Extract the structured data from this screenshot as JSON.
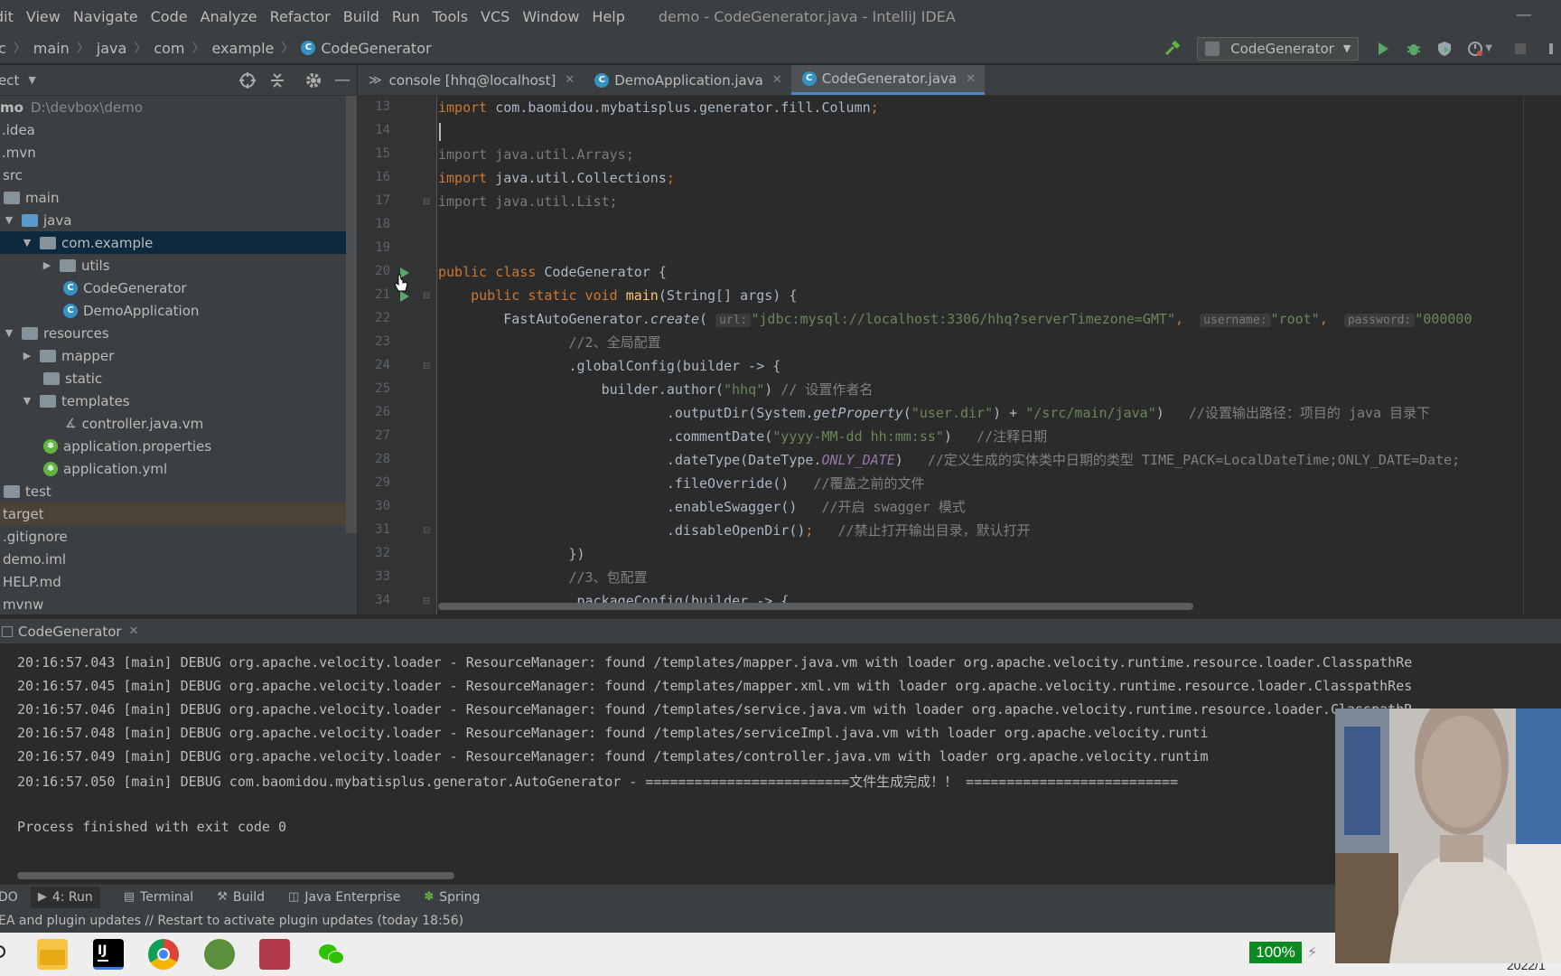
{
  "menubar": {
    "items": [
      "dit",
      "View",
      "Navigate",
      "Code",
      "Analyze",
      "Refactor",
      "Build",
      "Run",
      "Tools",
      "VCS",
      "Window",
      "Help"
    ],
    "window_title": "demo - CodeGenerator.java - IntelliJ IDEA"
  },
  "navbar": {
    "crumbs": [
      "c",
      "main",
      "java",
      "com",
      "example",
      "CodeGenerator"
    ],
    "run_config": "CodeGenerator"
  },
  "project": {
    "header": "ect",
    "rows": [
      {
        "label": "mo",
        "extra": "D:\\devbox\\demo"
      },
      {
        "label": ".idea"
      },
      {
        "label": ".mvn"
      },
      {
        "label": "src"
      },
      {
        "label": "main"
      },
      {
        "label": "java"
      },
      {
        "label": "com.example"
      },
      {
        "label": "utils"
      },
      {
        "label": "CodeGenerator"
      },
      {
        "label": "DemoApplication"
      },
      {
        "label": "resources"
      },
      {
        "label": "mapper"
      },
      {
        "label": "static"
      },
      {
        "label": "templates"
      },
      {
        "label": "controller.java.vm"
      },
      {
        "label": "application.properties"
      },
      {
        "label": "application.yml"
      },
      {
        "label": "test"
      },
      {
        "label": "target"
      },
      {
        "label": ".gitignore"
      },
      {
        "label": "demo.iml"
      },
      {
        "label": "HELP.md"
      },
      {
        "label": "mvnw"
      }
    ]
  },
  "tabs": [
    {
      "label": "console [hhq@localhost]"
    },
    {
      "label": "DemoApplication.java"
    },
    {
      "label": "CodeGenerator.java"
    }
  ],
  "editor": {
    "line_numbers": [
      "13",
      "14",
      "15",
      "16",
      "17",
      "18",
      "19",
      "20",
      "21",
      "22",
      "23",
      "24",
      "25",
      "26",
      "27",
      "28",
      "29",
      "30",
      "31",
      "32",
      "33",
      "34"
    ],
    "lines": {
      "l13a": "import ",
      "l13b": "com.baomidou.mybatisplus.generator.fill.Column",
      "l13c": ";",
      "l15": "import java.util.Arrays;",
      "l16a": "import ",
      "l16b": "java.util.Collections",
      "l16c": ";",
      "l17": "import java.util.List;",
      "l20a": "public class ",
      "l20b": "CodeGenerator {",
      "l21a": "    public static void ",
      "l21b": "main",
      "l21c": "(String[] args) {",
      "l22a": "        FastAutoGenerator.",
      "l22b": "create",
      "l22c": "( ",
      "l22h1": "url:",
      "l22s1": "\"jdbc:mysql://localhost:3306/hhq?serverTimezone=GMT\"",
      "l22d1": ",  ",
      "l22h2": "username:",
      "l22s2": "\"root\"",
      "l22d2": ",  ",
      "l22h3": "password:",
      "l22s3": "\"000000",
      "l23": "                //2、全局配置",
      "l24": "                .globalConfig(builder -> {",
      "l25a": "                    builder.author(",
      "l25b": "\"hhq\"",
      "l25c": ") ",
      "l25d": "// 设置作者名",
      "l26a": "                            .outputDir(System.",
      "l26b": "getProperty",
      "l26c": "(",
      "l26d": "\"user.dir\"",
      "l26e": ") + ",
      "l26f": "\"/src/main/java\"",
      "l26g": ")   ",
      "l26h": "//设置输出路径：项目的 java 目录下",
      "l27a": "                            .commentDate(",
      "l27b": "\"yyyy-MM-dd hh:mm:ss\"",
      "l27c": ")   ",
      "l27d": "//注释日期",
      "l28a": "                            .dateType(DateType.",
      "l28b": "ONLY_DATE",
      "l28c": ")   ",
      "l28d": "//定义生成的实体类中日期的类型 TIME_PACK=LocalDateTime;ONLY_DATE=Date;",
      "l29a": "                            .fileOverride()   ",
      "l29b": "//覆盖之前的文件",
      "l30a": "                            .enableSwagger()   ",
      "l30b": "//开启 swagger 模式",
      "l31a": "                            .disableOpenDir()",
      "l31b": ";",
      "l31c": "   ",
      "l31d": "//禁止打开输出目录，默认打开",
      "l32": "                })",
      "l33": "                //3、包配置",
      "l34": "                .packageConfig(builder -> {"
    }
  },
  "run": {
    "tab_label": "CodeGenerator",
    "output": [
      "20:16:57.043 [main] DEBUG org.apache.velocity.loader - ResourceManager: found /templates/mapper.java.vm with loader org.apache.velocity.runtime.resource.loader.ClasspathRe",
      "20:16:57.045 [main] DEBUG org.apache.velocity.loader - ResourceManager: found /templates/mapper.xml.vm with loader org.apache.velocity.runtime.resource.loader.ClasspathRes",
      "20:16:57.046 [main] DEBUG org.apache.velocity.loader - ResourceManager: found /templates/service.java.vm with loader org.apache.velocity.runtime.resource.loader.ClasspathR",
      "20:16:57.048 [main] DEBUG org.apache.velocity.loader - ResourceManager: found /templates/serviceImpl.java.vm with loader org.apache.velocity.runti",
      "20:16:57.049 [main] DEBUG org.apache.velocity.loader - ResourceManager: found /templates/controller.java.vm with loader org.apache.velocity.runtim",
      "20:16:57.050 [main] DEBUG com.baomidou.mybatisplus.generator.AutoGenerator - =========================文件生成完成！！ ==========================",
      "",
      "Process finished with exit code 0"
    ]
  },
  "toolwindows": [
    {
      "label": "DO"
    },
    {
      "label": "4: Run"
    },
    {
      "label": "Terminal"
    },
    {
      "label": "Build"
    },
    {
      "label": "Java Enterprise"
    },
    {
      "label": "Spring"
    }
  ],
  "status": {
    "message": "EA and plugin updates // Restart to activate plugin updates (today 18:56)"
  },
  "taskbar": {
    "battery": "100%",
    "clock": "2022/1"
  },
  "colors": {
    "accent": "#4a88c7",
    "selection": "#0d293e",
    "keyword": "#cc7832",
    "string": "#6a8759",
    "comment": "#808080"
  }
}
